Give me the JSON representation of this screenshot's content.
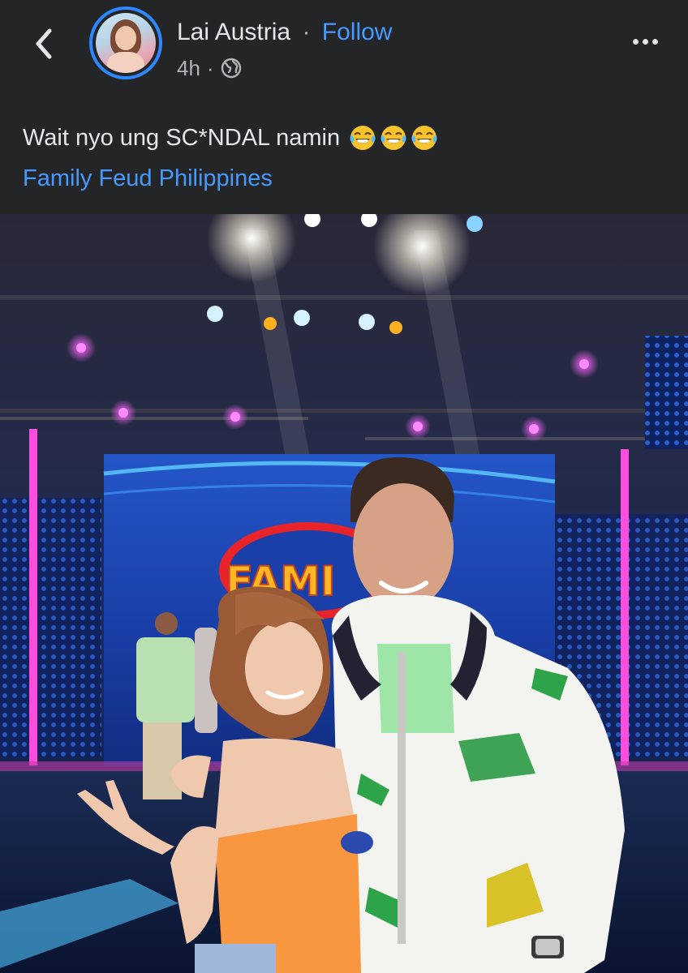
{
  "post": {
    "author": "Lai Austria",
    "separator": "·",
    "follow_label": "Follow",
    "timestamp": "4h",
    "meta_separator": "·",
    "privacy_icon": "globe-icon",
    "caption": "Wait nyo ung SC*NDAL namin",
    "emoji": [
      "face-with-tears-of-joy",
      "face-with-tears-of-joy",
      "face-with-tears-of-joy"
    ],
    "tagged_page": "Family Feud Philippines"
  },
  "nav": {
    "back_icon": "chevron-left-icon",
    "more_icon": "more-horizontal-icon"
  },
  "photo": {
    "stage_logo": "FAMI",
    "colors": {
      "background": "#242526",
      "text": "#e4e6eb",
      "secondary_text": "#b0b3b8",
      "link": "#4599ff",
      "avatar_ring": "#2d88ff"
    }
  }
}
